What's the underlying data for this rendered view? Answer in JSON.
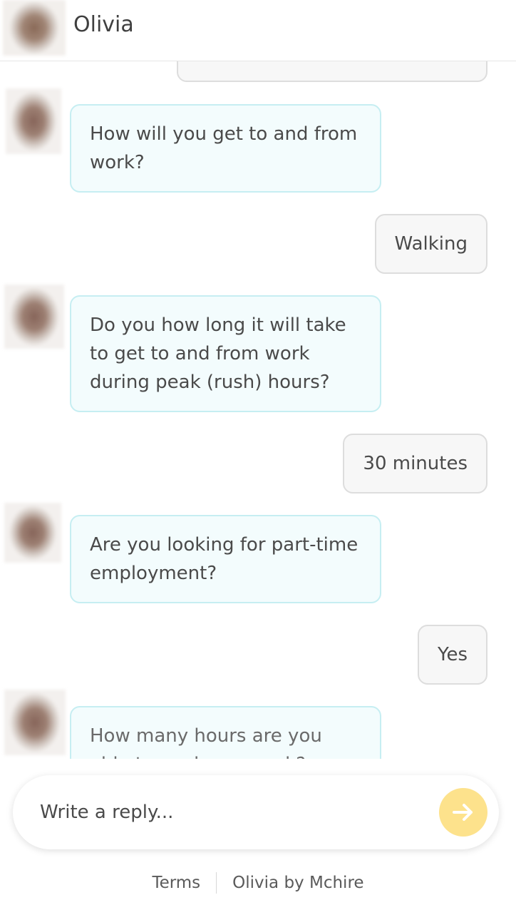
{
  "header": {
    "name": "Olivia"
  },
  "messages": [
    {
      "sender": "user",
      "text": "",
      "partial": true
    },
    {
      "sender": "bot",
      "text": "How will you get to and from work?"
    },
    {
      "sender": "user",
      "text": "Walking"
    },
    {
      "sender": "bot",
      "text": "Do you how long it will take to get to and from work during peak (rush) hours?"
    },
    {
      "sender": "user",
      "text": "30 minutes"
    },
    {
      "sender": "bot",
      "text": "Are you looking for part-time employment?"
    },
    {
      "sender": "user",
      "text": "Yes"
    },
    {
      "sender": "bot",
      "text": "How many hours are you able to work per week?",
      "partial": true
    }
  ],
  "composer": {
    "placeholder": "Write a reply...",
    "value": "",
    "send_icon": "arrow-right-icon",
    "send_color": "#fde28c"
  },
  "footer": {
    "terms": "Terms",
    "brand": "Olivia by Mchire"
  }
}
